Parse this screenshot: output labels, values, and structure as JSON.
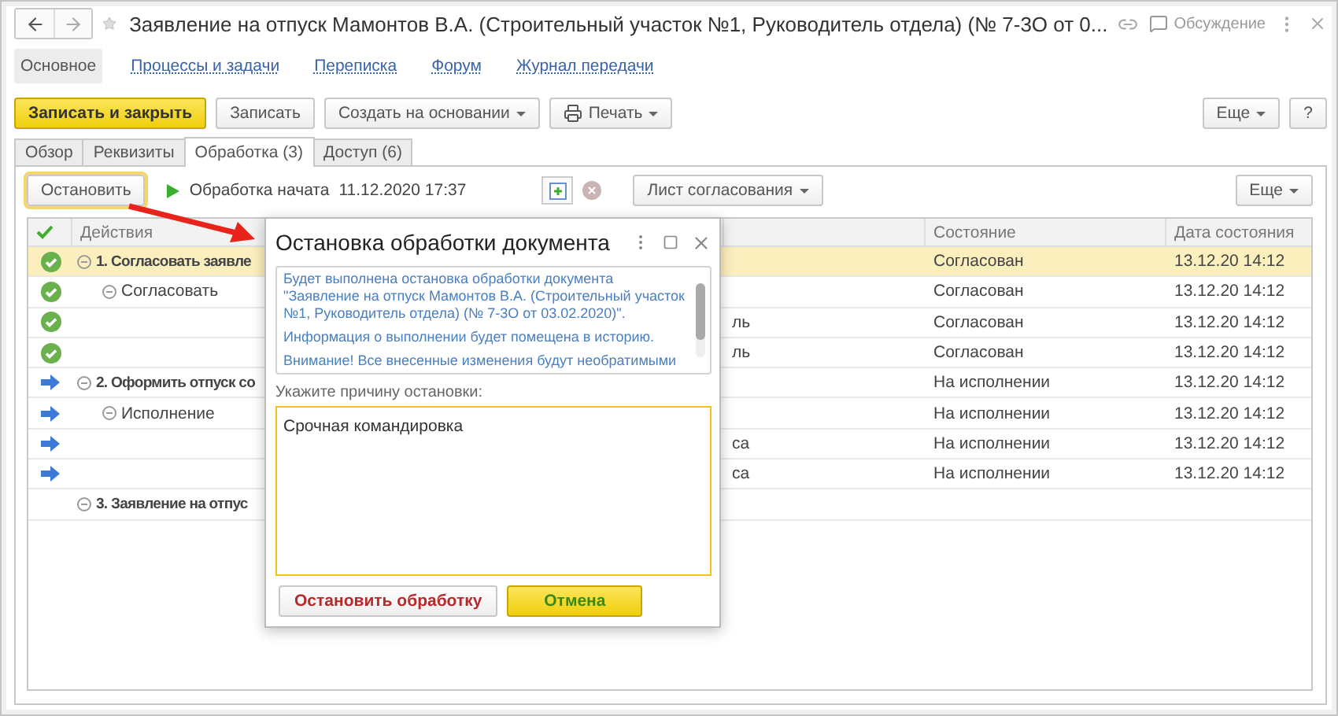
{
  "window": {
    "title": "Заявление на отпуск Мамонтов В.А. (Строительный участок №1, Руководитель отдела) (№ 7-3О от 0...",
    "discussion": "Обсуждение"
  },
  "sections": [
    {
      "label": "Основное",
      "selected": true
    },
    {
      "label": "Процессы и задачи",
      "selected": false
    },
    {
      "label": "Переписка",
      "selected": false
    },
    {
      "label": "Форум",
      "selected": false
    },
    {
      "label": "Журнал передачи",
      "selected": false
    }
  ],
  "toolbar": {
    "buttons": [
      {
        "label": "Записать и закрыть",
        "kind": "primary"
      },
      {
        "label": "Записать",
        "kind": "plain"
      },
      {
        "label": "Создать на основании",
        "kind": "dropdown"
      },
      {
        "label": "Печать",
        "kind": "print"
      }
    ],
    "more": "Еще",
    "help": "?"
  },
  "tabs": [
    {
      "label": "Обзор",
      "selected": false
    },
    {
      "label": "Реквизиты",
      "selected": false
    },
    {
      "label": "Обработка (3)",
      "selected": true
    },
    {
      "label": "Доступ (6)",
      "selected": false
    }
  ],
  "processing": {
    "stop_button": "Остановить",
    "status": "Обработка начата",
    "started_at": "11.12.2020 17:37",
    "sheet_button": "Лист согласования",
    "more": "Еще"
  },
  "table": {
    "columns": [
      "Действия",
      "Состояние",
      "Дата состояния"
    ],
    "rows": [
      {
        "kind": "done",
        "action": "1. Согласовать заявле",
        "state": "Согласован",
        "date": "13.12.20 14:12",
        "selected": true,
        "expanded": true,
        "children": [
          {
            "kind": "done",
            "action": "Согласовать",
            "state": "Согласован",
            "date": "13.12.20 14:12",
            "selected": false,
            "expanded": true,
            "children": [
              {
                "kind": "done",
                "column_3": "ль",
                "state": "Согласован",
                "date": "13.12.20 14:12",
                "selected": false
              },
              {
                "kind": "done",
                "column_3": "ль",
                "state": "Согласован",
                "date": "13.12.20 14:12",
                "selected": false
              }
            ]
          }
        ]
      },
      {
        "kind": "in_progress",
        "action": "2. Оформить отпуск со",
        "state": "На исполнении",
        "date": "13.12.20 14:12",
        "selected": false,
        "expanded": true,
        "children": [
          {
            "kind": "in_progress",
            "action": "Исполнение",
            "state": "На исполнении",
            "date": "13.12.20 14:12",
            "selected": false,
            "expanded": true,
            "children": [
              {
                "kind": "in_progress",
                "column_3": "са",
                "state": "На исполнении",
                "date": "13.12.20 14:12",
                "selected": false
              },
              {
                "kind": "in_progress",
                "column_3": "са",
                "state": "На исполнении",
                "date": "13.12.20 14:12",
                "selected": false
              }
            ]
          }
        ]
      },
      {
        "kind": "group",
        "action": "3. Заявление на отпус",
        "selected": false,
        "expanded": true
      }
    ]
  },
  "dialog": {
    "title": "Остановка обработки документа",
    "info": [
      "Будет выполнена остановка обработки документа \"Заявление на отпуск Мамонтов В.А. (Строительный участок №1, Руководитель отдела) (№ 7-3О от 03.02.2020)\".",
      "Информация о выполнении будет помещена в историю.",
      "Внимание! Все внесенные изменения будут необратимыми"
    ],
    "reason_label": "Укажите причину остановки:",
    "reason_value": "Срочная командировка",
    "stop_button": "Остановить обработку",
    "cancel_button": "Отмена"
  }
}
